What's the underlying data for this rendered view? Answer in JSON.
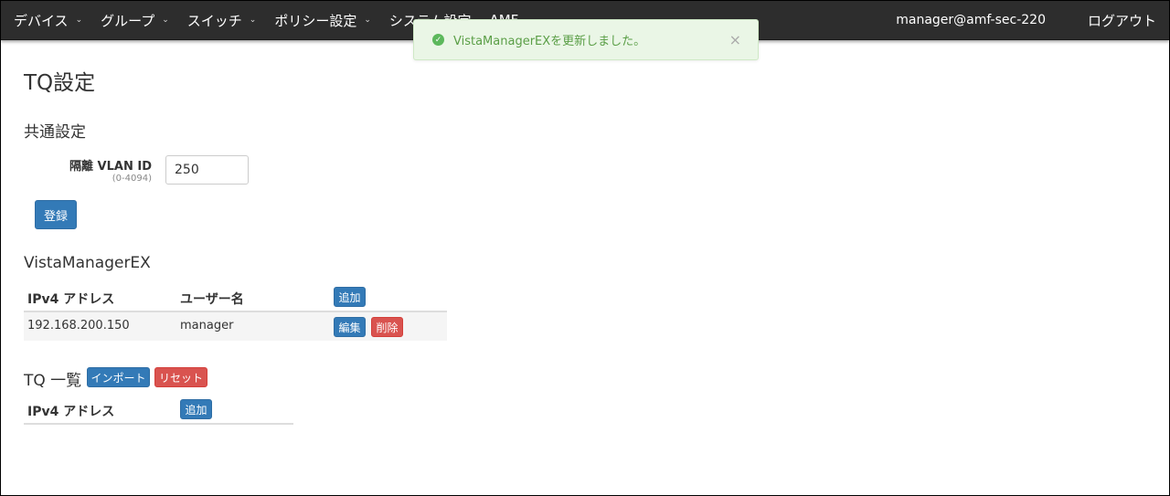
{
  "nav": {
    "items": [
      {
        "label": "デバイス"
      },
      {
        "label": "グループ"
      },
      {
        "label": "スイッチ"
      },
      {
        "label": "ポリシー設定"
      },
      {
        "label": "システム設定"
      },
      {
        "label": "AMF"
      }
    ],
    "user": "manager@amf-sec-220",
    "logout": "ログアウト"
  },
  "toast": {
    "message": "VistaManagerEXを更新しました。",
    "close": "×"
  },
  "page": {
    "title": "TQ設定"
  },
  "common": {
    "title": "共通設定",
    "vlan_label": "隔離 VLAN ID",
    "vlan_hint": "(0-4094)",
    "vlan_value": "250",
    "register_button": "登録"
  },
  "vista": {
    "title": "VistaManagerEX",
    "headers": {
      "ipv4": "IPv4 アドレス",
      "username": "ユーザー名"
    },
    "add_button": "追加",
    "rows": [
      {
        "ipv4": "192.168.200.150",
        "username": "manager",
        "edit": "編集",
        "delete": "削除"
      }
    ]
  },
  "tq": {
    "title": "TQ 一覧",
    "import_button": "インポート",
    "reset_button": "リセット",
    "headers": {
      "ipv4": "IPv4 アドレス"
    },
    "add_button": "追加"
  },
  "colors": {
    "navbar": "#2d2d2d",
    "primary": "#337ab7",
    "danger": "#d9534f",
    "success_bg": "#eaf6e6",
    "success_text": "#5a9e46"
  }
}
